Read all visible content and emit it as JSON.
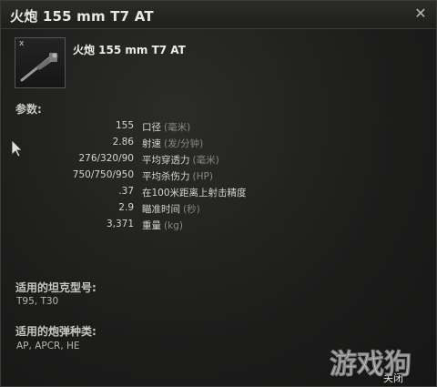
{
  "window": {
    "title": "火炮 155 mm T7 AT",
    "close_icon": "close-x-icon",
    "close_button_label": "关闭"
  },
  "item": {
    "thumbnail_icon": "gun-icon",
    "thumbnail_mark": "x",
    "name": "火炮 155 mm T7 AT"
  },
  "params_heading": "参数:",
  "params": [
    {
      "value": "155",
      "label": "口径",
      "unit": "(毫米)"
    },
    {
      "value": "2.86",
      "label": "射速",
      "unit": "(发/分钟)"
    },
    {
      "value": "276/320/90",
      "label": "平均穿透力",
      "unit": "(毫米)"
    },
    {
      "value": "750/750/950",
      "label": "平均杀伤力",
      "unit": "(HP)"
    },
    {
      "value": ".37",
      "label": "在100米距离上射击精度",
      "unit": ""
    },
    {
      "value": "2.9",
      "label": "瞄准时间",
      "unit": "(秒)"
    },
    {
      "value": "3,371",
      "label": "重量",
      "unit": "(kg)"
    }
  ],
  "compatible_tanks": {
    "heading": "适用的坦克型号:",
    "value": "T95, T30"
  },
  "compatible_ammo": {
    "heading": "适用的炮弹种类:",
    "value": "AP, APCR, HE"
  },
  "watermark": {
    "text": "游戏狗"
  },
  "colors": {
    "background": "#1c1c1b",
    "text_primary": "#d8d6cf",
    "text_muted": "#8a8882"
  }
}
